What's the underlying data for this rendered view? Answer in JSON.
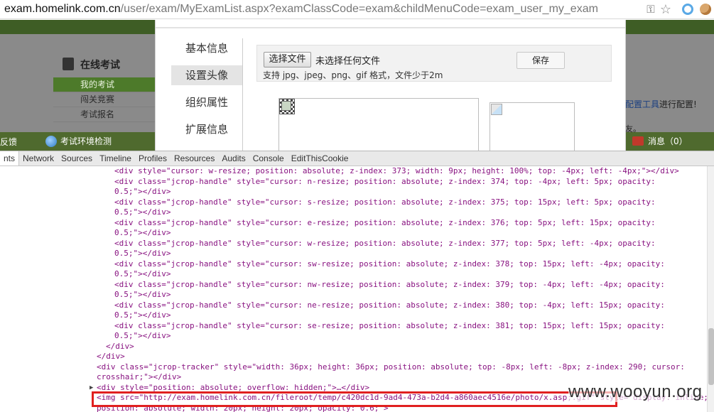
{
  "browser": {
    "url_host": "exam.homelink.com.cn",
    "url_path": "/user/exam/MyExamList.aspx?examClassCode=exam&childMenuCode=exam_user_my_exam",
    "icons": [
      "key-icon",
      "star-icon",
      "extension-icon",
      "cookie-extension-icon"
    ]
  },
  "webpage": {
    "sidebar_title": "在线考试",
    "sidebar_items": [
      {
        "label": "我的考试",
        "active": true
      },
      {
        "label": "闯关竞赛",
        "active": false
      },
      {
        "label": "考试报名",
        "active": false
      }
    ],
    "right_hint_link": "配置工具",
    "right_hint_text": "进行配置!",
    "right_hint_tail": "友。",
    "bottom_bar": {
      "feedback": "反馈",
      "env_check": "考试环境检测",
      "messages": "消息（0）"
    }
  },
  "modal": {
    "nav": [
      {
        "label": "基本信息",
        "active": false
      },
      {
        "label": "设置头像",
        "active": true
      },
      {
        "label": "组织属性",
        "active": false
      },
      {
        "label": "扩展信息",
        "active": false
      }
    ],
    "choose_file_label": "选择文件",
    "no_file_text": "未选择任何文件",
    "save_label": "保存",
    "hint": "支持 jpg、jpeg、png、gif 格式，文件少于2m"
  },
  "devtools": {
    "tabs": [
      "nts",
      "Network",
      "Sources",
      "Timeline",
      "Profiles",
      "Resources",
      "Audits",
      "Console",
      "EditThisCookie"
    ],
    "active_tab": "nts"
  },
  "code_lines": [
    "<div style=\"cursor: w-resize; position: absolute; z-index: 373; width: 9px; height: 100%; top: -4px; left: -4px;\"></div>",
    "<div class=\"jcrop-handle\" style=\"cursor: n-resize; position: absolute; z-index: 374; top: -4px; left: 5px; opacity:",
    "0.5;\"></div>",
    "<div class=\"jcrop-handle\" style=\"cursor: s-resize; position: absolute; z-index: 375; top: 15px; left: 5px; opacity:",
    "0.5;\"></div>",
    "<div class=\"jcrop-handle\" style=\"cursor: e-resize; position: absolute; z-index: 376; top: 5px; left: 15px; opacity:",
    "0.5;\"></div>",
    "<div class=\"jcrop-handle\" style=\"cursor: w-resize; position: absolute; z-index: 377; top: 5px; left: -4px; opacity:",
    "0.5;\"></div>",
    "<div class=\"jcrop-handle\" style=\"cursor: sw-resize; position: absolute; z-index: 378; top: 15px; left: -4px; opacity:",
    "0.5;\"></div>",
    "<div class=\"jcrop-handle\" style=\"cursor: nw-resize; position: absolute; z-index: 379; top: -4px; left: -4px; opacity:",
    "0.5;\"></div>",
    "<div class=\"jcrop-handle\" style=\"cursor: ne-resize; position: absolute; z-index: 380; top: -4px; left: 15px; opacity:",
    "0.5;\"></div>",
    "<div class=\"jcrop-handle\" style=\"cursor: se-resize; position: absolute; z-index: 381; top: 15px; left: 15px; opacity:",
    "0.5;\"></div>",
    "</div>",
    "</div>",
    "<div class=\"jcrop-tracker\" style=\"width: 36px; height: 36px; position: absolute; top: -8px; left: -8px; z-index: 290; cursor:",
    "crosshair;\"></div>",
    "<div style=\"position: absolute; overflow: hidden;\">…</div>",
    "<img src=\"http://exam.homelink.com.cn/fileroot/temp/c420dc1d-9ad4-473a-b2d4-a860aec4516e/photo/x.asp;.gif\" style=\"display: inline;",
    "position: absolute; width: 20px; height: 20px; opacity: 0.6;\">"
  ],
  "watermark": "www.wooyun.org"
}
